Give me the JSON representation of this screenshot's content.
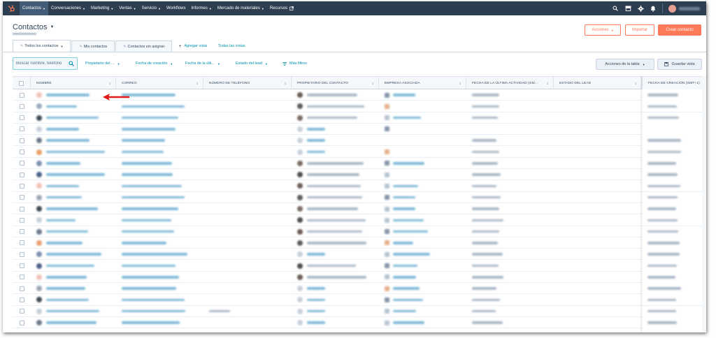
{
  "nav": {
    "items": [
      {
        "label": "Contactos",
        "caret": true,
        "active": true
      },
      {
        "label": "Conversaciones",
        "caret": true
      },
      {
        "label": "Marketing",
        "caret": true
      },
      {
        "label": "Ventas",
        "caret": true
      },
      {
        "label": "Servicio",
        "caret": true
      },
      {
        "label": "Workflows",
        "caret": false
      },
      {
        "label": "Informes",
        "caret": true
      },
      {
        "label": "Mercado de materiales",
        "caret": true
      },
      {
        "label": "Recursos",
        "caret": false,
        "external": true
      }
    ],
    "icons": [
      "search-icon",
      "marketplace-icon",
      "gear-icon",
      "bell-icon"
    ]
  },
  "header": {
    "title": "Contactos",
    "acciones_label": "Acciones",
    "importar_label": "Importar",
    "crear_label": "Crear contacto"
  },
  "tabs": {
    "items": [
      {
        "label": "Todos los contactos",
        "active": true,
        "caret": true
      },
      {
        "label": "Mis contactos",
        "active": false
      },
      {
        "label": "Contactos sin asignar",
        "active": false
      }
    ],
    "agregar_label": "Agregar vista",
    "todas_label": "Todas las vistas"
  },
  "filters": {
    "search_placeholder": "Buscar nombre, teléfono",
    "items": [
      {
        "label": "Propietario del ..."
      },
      {
        "label": "Fecha de creación"
      },
      {
        "label": "Fecha de la últi..."
      },
      {
        "label": "Estado del lead"
      }
    ],
    "more_label": "Más filtros",
    "table_actions_label": "Acciones de la tabla",
    "save_view_label": "Guardar vista"
  },
  "table": {
    "columns": [
      {
        "label": "NOMBRE"
      },
      {
        "label": "CORREO"
      },
      {
        "label": "NÚMERO DE TELÉFONO"
      },
      {
        "label": "PROPIETARIO DEL CONTACTO"
      },
      {
        "label": "EMPRESA ASOCIADA"
      },
      {
        "label": "FECHA DE LA ÚLTIMA ACTIVIDAD (GM..."
      },
      {
        "label": "ESTADO DEL LEAD"
      },
      {
        "label": "FECHA DE CREACIÓN (GMT+1)"
      }
    ]
  },
  "colors": {
    "nav_bg": "#2d3e50",
    "accent": "#ff7a59",
    "link": "#0091ae",
    "annotation_arrow": "#e01b1b"
  }
}
